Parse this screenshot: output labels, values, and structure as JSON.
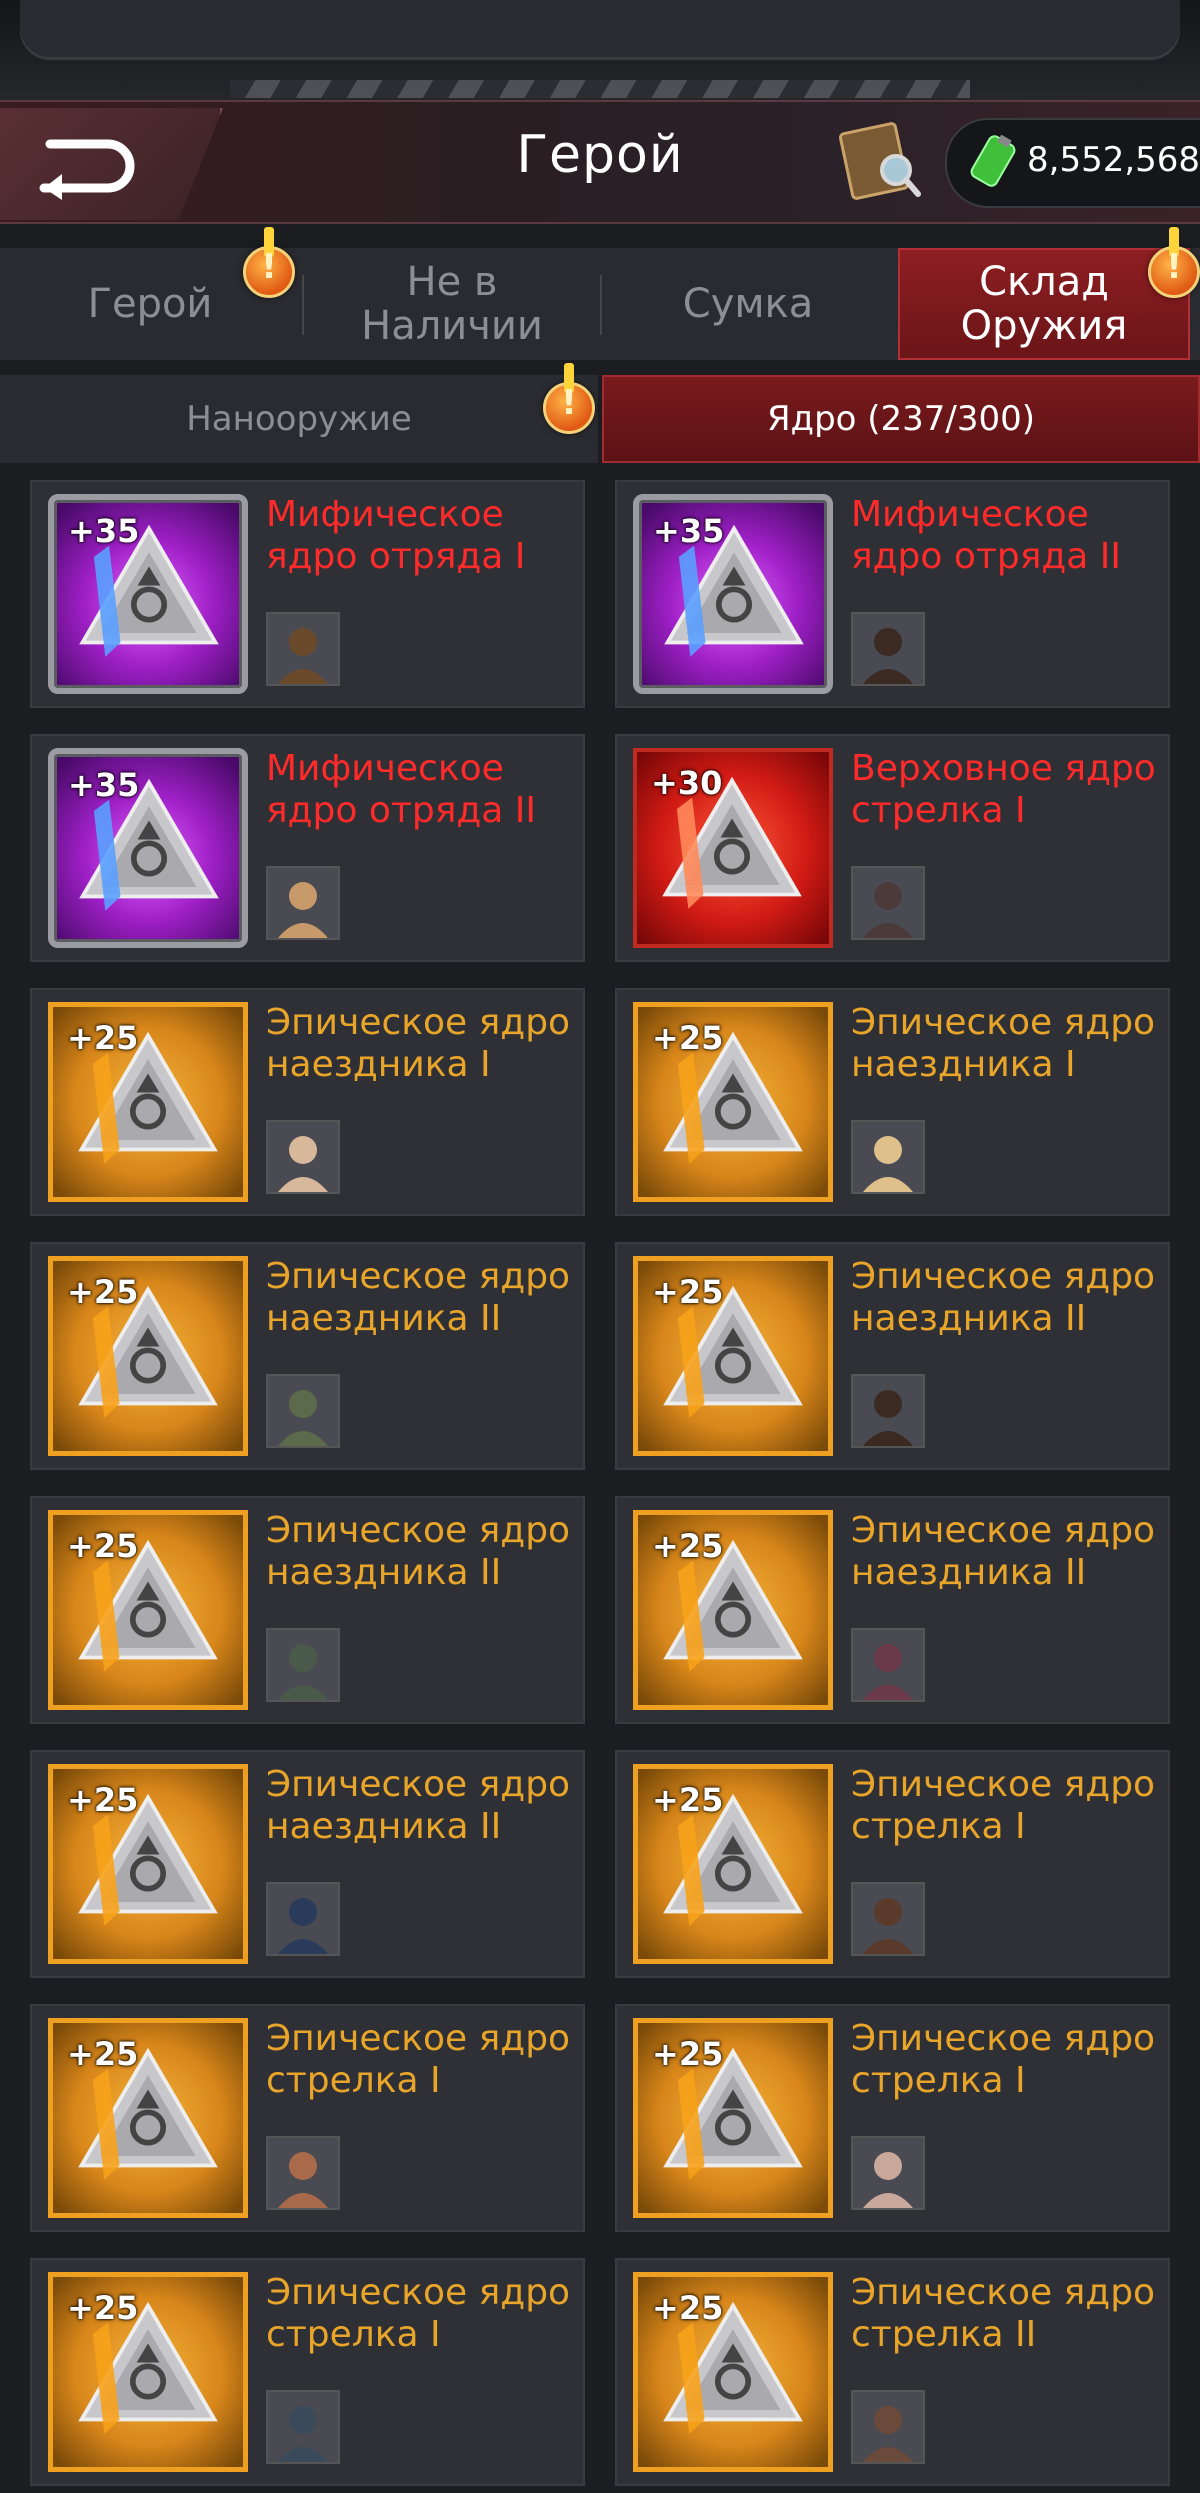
{
  "header": {
    "title": "Герой",
    "currency_value": "8,552,568"
  },
  "tabs": [
    {
      "label": "Герой",
      "active": false,
      "alert": true
    },
    {
      "label": "Не в Наличии",
      "active": false,
      "alert": false
    },
    {
      "label": "Сумка",
      "active": false,
      "alert": false
    },
    {
      "label": "Склад Оружия",
      "active": true,
      "alert": true
    }
  ],
  "sub_tabs": [
    {
      "label": "Нанооружие",
      "active": false,
      "alert": true
    },
    {
      "label": "Ядро (237/300)",
      "active": true,
      "alert": false
    }
  ],
  "items": [
    {
      "level": "+35",
      "name": "Мифическое ядро отряда I",
      "rarity": "myth",
      "portrait_color": "#6a4a2a"
    },
    {
      "level": "+35",
      "name": "Мифическое ядро отряда II",
      "rarity": "myth",
      "portrait_color": "#3a2a22"
    },
    {
      "level": "+35",
      "name": "Мифическое ядро отряда II",
      "rarity": "myth",
      "portrait_color": "#c89a6a"
    },
    {
      "level": "+30",
      "name": "Верховное ядро стрелка I",
      "rarity": "supreme",
      "portrait_color": "#4a3a3a"
    },
    {
      "level": "+25",
      "name": "Эпическое ядро наездника I",
      "rarity": "epic",
      "portrait_color": "#d8b89a"
    },
    {
      "level": "+25",
      "name": "Эпическое ядро наездника I",
      "rarity": "epic",
      "portrait_color": "#e0c08a"
    },
    {
      "level": "+25",
      "name": "Эпическое ядро наездника II",
      "rarity": "epic",
      "portrait_color": "#5a6a4a"
    },
    {
      "level": "+25",
      "name": "Эпическое ядро наездника II",
      "rarity": "epic",
      "portrait_color": "#3a2a22"
    },
    {
      "level": "+25",
      "name": "Эпическое ядро наездника II",
      "rarity": "epic",
      "portrait_color": "#4a5a4a"
    },
    {
      "level": "+25",
      "name": "Эпическое ядро наездника II",
      "rarity": "epic",
      "portrait_color": "#6a3a4a"
    },
    {
      "level": "+25",
      "name": "Эпическое ядро наездника II",
      "rarity": "epic",
      "portrait_color": "#2a3a5a"
    },
    {
      "level": "+25",
      "name": "Эпическое ядро стрелка I",
      "rarity": "epic",
      "portrait_color": "#5a3a2a"
    },
    {
      "level": "+25",
      "name": "Эпическое ядро стрелка I",
      "rarity": "epic",
      "portrait_color": "#a86a4a"
    },
    {
      "level": "+25",
      "name": "Эпическое ядро стрелка I",
      "rarity": "epic",
      "portrait_color": "#c8a89a"
    },
    {
      "level": "+25",
      "name": "Эпическое ядро стрелка I",
      "rarity": "epic",
      "portrait_color": "#3a4a5a"
    },
    {
      "level": "+25",
      "name": "Эпическое ядро стрелка II",
      "rarity": "epic",
      "portrait_color": "#6a4a3a"
    }
  ],
  "colors": {
    "myth_name": "#ff2a2a",
    "epic_name": "#e8a52a",
    "active_tab": "#8e1e22"
  }
}
